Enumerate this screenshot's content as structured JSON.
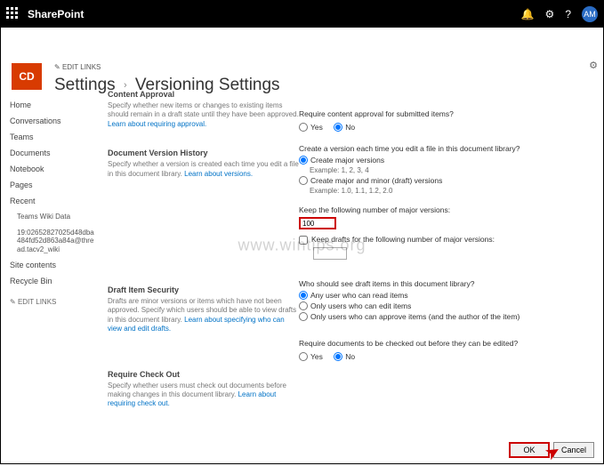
{
  "suite": {
    "title": "SharePoint",
    "avatar": "AM"
  },
  "header": {
    "logo_text": "CD",
    "edit_links": "EDIT LINKS",
    "breadcrumb_settings": "Settings",
    "breadcrumb_page": "Versioning Settings"
  },
  "nav": {
    "items": [
      "Home",
      "Conversations",
      "Teams",
      "Documents",
      "Notebook",
      "Pages",
      "Recent"
    ],
    "recent_child": "Teams Wiki Data",
    "long1": "19:02652827025d48dba484fd52d863a84a@thread.tacv2_wiki",
    "site_contents": "Site contents",
    "recycle": "Recycle Bin",
    "edit_links": "EDIT LINKS"
  },
  "sections": {
    "ca": {
      "title": "Content Approval",
      "desc": "Specify whether new items or changes to existing items should remain in a draft state until they have been approved.",
      "link": "Learn about requiring approval."
    },
    "dvh": {
      "title": "Document Version History",
      "desc": "Specify whether a version is created each time you edit a file in this document library.",
      "link": "Learn about versions."
    },
    "dis": {
      "title": "Draft Item Security",
      "desc": "Drafts are minor versions or items which have not been approved. Specify which users should be able to view drafts in this document library.",
      "link": "Learn about specifying who can view and edit drafts."
    },
    "rco": {
      "title": "Require Check Out",
      "desc": "Specify whether users must check out documents before making changes in this document library.",
      "link": "Learn about requiring check out."
    }
  },
  "form": {
    "approval_q": "Require content approval for submitted items?",
    "yes": "Yes",
    "no": "No",
    "create_version_q": "Create a version each time you edit a file in this document library?",
    "major": "Create major versions",
    "major_ex": "Example: 1, 2, 3, 4",
    "minor": "Create major and minor (draft) versions",
    "minor_ex": "Example: 1.0, 1.1, 1.2, 2.0",
    "keep_major": "Keep the following number of major versions:",
    "keep_major_val": "100",
    "keep_drafts": "Keep drafts for the following number of major versions:",
    "who_q": "Who should see draft items in this document library?",
    "who1": "Any user who can read items",
    "who2": "Only users who can edit items",
    "who3": "Only users who can approve items (and the author of the item)",
    "checkout_q": "Require documents to be checked out before they can be edited?"
  },
  "buttons": {
    "ok": "OK",
    "cancel": "Cancel"
  },
  "watermark": "www.wintips.org"
}
